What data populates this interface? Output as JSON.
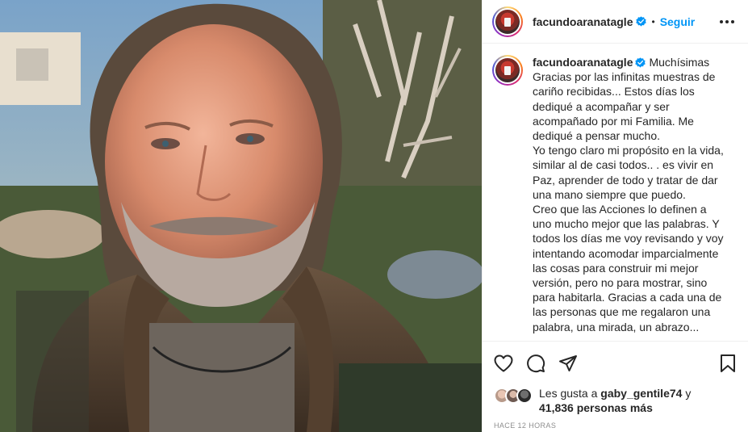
{
  "post": {
    "username": "facundoaranatagle",
    "follow_label": "Seguir",
    "separator": "•",
    "caption_lines": [
      "Gracias por las infinitas muestras de",
      "cariño recibidas... Estos días los",
      "dediqué a acompañar y ser",
      "acompañado por mi Familia. Me",
      "dediqué a pensar mucho.",
      "Yo tengo claro mi propósito en la vida,",
      "similar al de casi todos.. . es vivir en",
      "Paz, aprender de todo y tratar de dar",
      "una mano siempre que puedo.",
      "Creo que las Acciones lo definen a",
      "uno mucho mejor que las palabras. Y",
      "todos los días me voy revisando y voy",
      "intentando acomodar imparcialmente",
      "las cosas para construir mi mejor",
      "versión, pero no para mostrar, sino",
      "para habitarla. Gracias a cada una de",
      "las personas que me regalaron una",
      "palabra, una mirada, un abrazo..."
    ],
    "caption_first_word": "Muchísimas",
    "likes": {
      "prefix": "Les gusta a",
      "user": "gaby_gentile74",
      "connector": "y",
      "count": "41,836 personas más"
    },
    "timestamp": "Hace 12 horas"
  },
  "icons": {
    "verified": "verified-badge-icon",
    "more": "more-horizontal-icon",
    "like": "heart-icon",
    "comment": "comment-icon",
    "share": "paper-plane-icon",
    "save": "bookmark-icon"
  },
  "colors": {
    "accent": "#0095f6",
    "text": "#262626",
    "muted": "#8e8e8e",
    "border": "#efefef"
  }
}
